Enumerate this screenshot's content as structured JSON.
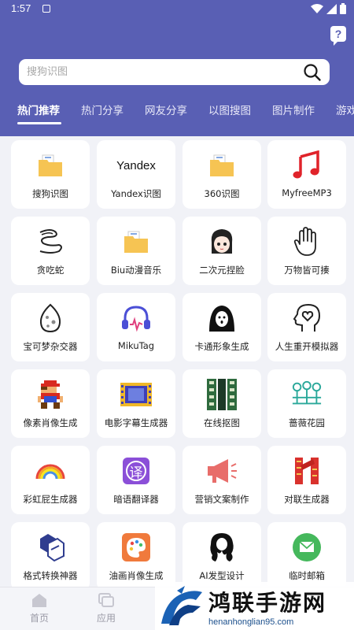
{
  "status_bar": {
    "time": "1:57"
  },
  "search": {
    "placeholder": "搜狗识图"
  },
  "tabs": [
    {
      "label": "热门推荐",
      "active": true
    },
    {
      "label": "热门分享"
    },
    {
      "label": "网友分享"
    },
    {
      "label": "以图搜图"
    },
    {
      "label": "图片制作"
    },
    {
      "label": "游戏"
    }
  ],
  "tools": [
    {
      "label": "搜狗识图",
      "icon": "folder-icon"
    },
    {
      "label": "Yandex识图",
      "icon": "yandex-logo",
      "logo_text": "Yandex"
    },
    {
      "label": "360识图",
      "icon": "folder-icon"
    },
    {
      "label": "MyfreeMP3",
      "icon": "music-note-icon"
    },
    {
      "label": "贪吃蛇",
      "icon": "snake-icon"
    },
    {
      "label": "Biu动漫音乐",
      "icon": "folder-icon"
    },
    {
      "label": "二次元捏脸",
      "icon": "anime-face-icon"
    },
    {
      "label": "万物皆可揍",
      "icon": "hand-icon"
    },
    {
      "label": "宝可梦杂交器",
      "icon": "egg-icon"
    },
    {
      "label": "MikuTag",
      "icon": "headphones-icon"
    },
    {
      "label": "卡通形象生成",
      "icon": "ghost-icon"
    },
    {
      "label": "人生重开模拟器",
      "icon": "head-heart-icon"
    },
    {
      "label": "像素肖像生成",
      "icon": "pixel-mario-icon"
    },
    {
      "label": "电影字幕生成器",
      "icon": "film-strip-icon"
    },
    {
      "label": "在线抠图",
      "icon": "film-columns-icon"
    },
    {
      "label": "蔷薇花园",
      "icon": "garden-icon"
    },
    {
      "label": "彩虹屁生成器",
      "icon": "rainbow-icon"
    },
    {
      "label": "暗语翻译器",
      "icon": "translate-icon",
      "logo_text": "译"
    },
    {
      "label": "营销文案制作",
      "icon": "megaphone-icon"
    },
    {
      "label": "对联生成器",
      "icon": "couplet-icon"
    },
    {
      "label": "格式转换神器",
      "icon": "cube-convert-icon"
    },
    {
      "label": "油画肖像生成",
      "icon": "palette-icon"
    },
    {
      "label": "AI发型设计",
      "icon": "hair-icon"
    },
    {
      "label": "临时邮箱",
      "icon": "mail-icon"
    }
  ],
  "bottom_nav": [
    {
      "label": "首页",
      "icon": "home-icon"
    },
    {
      "label": "应用",
      "icon": "apps-icon"
    }
  ],
  "watermark": {
    "title": "鸿联手游网",
    "url": "henanhonglian95.com"
  },
  "colors": {
    "header": "#595fb4",
    "background": "#f1f2f7",
    "card": "#ffffff"
  }
}
